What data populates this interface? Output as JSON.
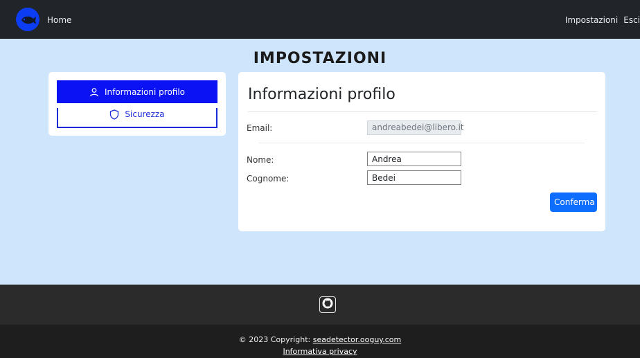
{
  "navbar": {
    "home_label": "Home",
    "right_items": [
      "Impostazioni",
      "Esci"
    ]
  },
  "page": {
    "title": "IMPOSTAZIONI"
  },
  "sidebar": {
    "items": [
      {
        "label": "Informazioni profilo",
        "icon": "user-icon",
        "active": true
      },
      {
        "label": "Sicurezza",
        "icon": "shield-icon",
        "active": false
      }
    ]
  },
  "profile": {
    "title": "Informazioni profilo",
    "email_label": "Email:",
    "email_value": "andreabedei@libero.it",
    "nome_label": "Nome:",
    "nome_value": "Andrea",
    "cognome_label": "Cognome:",
    "cognome_value": "Bedei",
    "confirm_label": "Conferma"
  },
  "footer": {
    "github_icon": "github-icon",
    "copyright_text": "© 2023 Copyright: ",
    "site_link": "seadetector.ooguy.com",
    "privacy_link": "Informativa privacy"
  },
  "colors": {
    "navbar_bg": "#212529",
    "main_bg": "#cfe5fb",
    "active_item": "#0b13f5",
    "primary_button": "#0d6efd"
  }
}
